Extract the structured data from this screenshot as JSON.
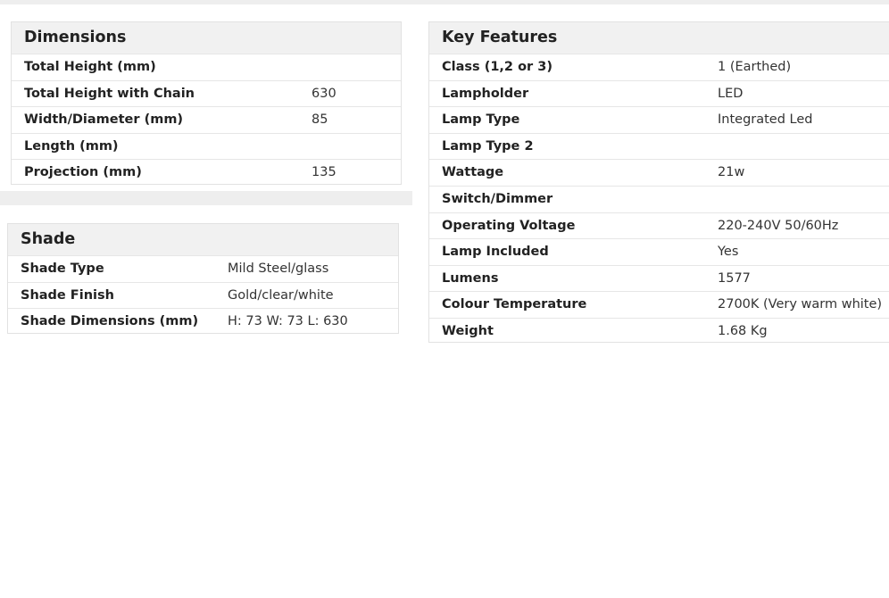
{
  "dimensions": {
    "title": "Dimensions",
    "rows": [
      {
        "label": "Total Height (mm)",
        "value": ""
      },
      {
        "label": "Total Height with Chain",
        "value": "630"
      },
      {
        "label": "Width/Diameter (mm)",
        "value": "85"
      },
      {
        "label": "Length (mm)",
        "value": ""
      },
      {
        "label": "Projection (mm)",
        "value": "135"
      }
    ]
  },
  "shade": {
    "title": "Shade",
    "rows": [
      {
        "label": "Shade Type",
        "value": "Mild Steel/glass"
      },
      {
        "label": "Shade Finish",
        "value": "Gold/clear/white"
      },
      {
        "label": "Shade Dimensions (mm)",
        "value": "H: 73 W: 73 L: 630"
      }
    ]
  },
  "features": {
    "title": "Key Features",
    "rows": [
      {
        "label": "Class (1,2 or 3)",
        "value": "1 (Earthed)"
      },
      {
        "label": "Lampholder",
        "value": "LED"
      },
      {
        "label": "Lamp Type",
        "value": "Integrated Led"
      },
      {
        "label": "Lamp Type 2",
        "value": ""
      },
      {
        "label": "Wattage",
        "value": "21w"
      },
      {
        "label": "Switch/Dimmer",
        "value": ""
      },
      {
        "label": "Operating Voltage",
        "value": "220-240V 50/60Hz"
      },
      {
        "label": "Lamp Included",
        "value": "Yes"
      },
      {
        "label": "Lumens",
        "value": "1577"
      },
      {
        "label": "Colour Temperature",
        "value": "2700K (Very warm white)"
      },
      {
        "label": "Weight",
        "value": "1.68 Kg"
      }
    ]
  }
}
